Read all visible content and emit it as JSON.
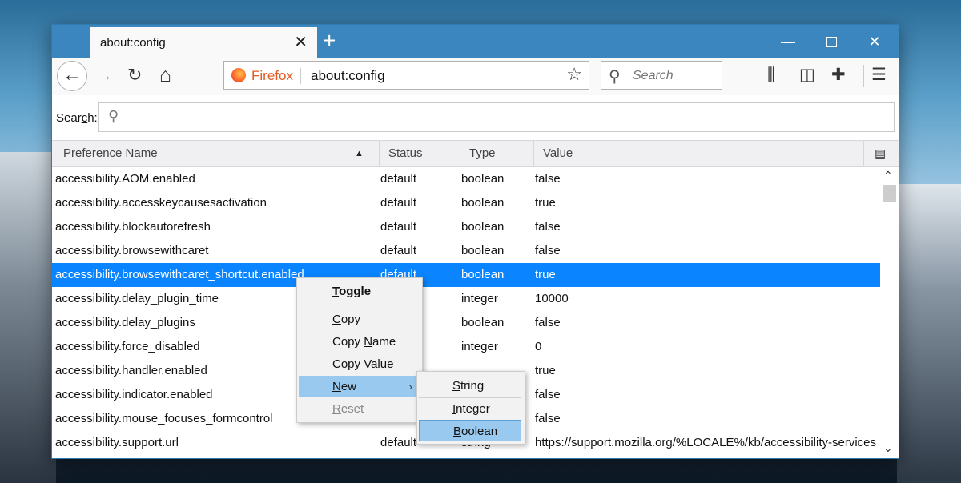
{
  "tab": {
    "title": "about:config",
    "close_glyph": "✕",
    "new_tab_glyph": "+"
  },
  "window_controls": {
    "minimize": "—",
    "close": "✕"
  },
  "navbar": {
    "back_glyph": "←",
    "forward_glyph": "→",
    "reload_glyph": "↻",
    "home_glyph": "⌂",
    "identity_label": "Firefox",
    "url": "about:config",
    "star_glyph": "☆",
    "search_placeholder": "Search",
    "search_glyph": "⚲",
    "library_glyph": "⫼",
    "sidebar_glyph": "◫",
    "extensions_glyph": "✚",
    "menu_glyph": "☰"
  },
  "filter": {
    "label_prefix": "Sear",
    "label_underlined": "c",
    "label_suffix": "h:",
    "icon_glyph": "⚲",
    "value": ""
  },
  "columns": {
    "name": "Preference Name",
    "status": "Status",
    "type": "Type",
    "value": "Value",
    "sort_glyph": "▲",
    "picker_glyph": "▤"
  },
  "rows": [
    {
      "name": "accessibility.AOM.enabled",
      "status": "default",
      "type": "boolean",
      "value": "false"
    },
    {
      "name": "accessibility.accesskeycausesactivation",
      "status": "default",
      "type": "boolean",
      "value": "true"
    },
    {
      "name": "accessibility.blockautorefresh",
      "status": "default",
      "type": "boolean",
      "value": "false"
    },
    {
      "name": "accessibility.browsewithcaret",
      "status": "default",
      "type": "boolean",
      "value": "false"
    },
    {
      "name": "accessibility.browsewithcaret_shortcut.enabled",
      "status": "default",
      "type": "boolean",
      "value": "true"
    },
    {
      "name": "accessibility.delay_plugin_time",
      "status": "",
      "type": "integer",
      "value": "10000"
    },
    {
      "name": "accessibility.delay_plugins",
      "status": "",
      "type": "boolean",
      "value": "false"
    },
    {
      "name": "accessibility.force_disabled",
      "status": "",
      "type": "integer",
      "value": "0"
    },
    {
      "name": "accessibility.handler.enabled",
      "status": "",
      "type": "",
      "value": "true"
    },
    {
      "name": "accessibility.indicator.enabled",
      "status": "",
      "type": "",
      "value": "false"
    },
    {
      "name": "accessibility.mouse_focuses_formcontrol",
      "status": "",
      "type": "",
      "value": "false"
    },
    {
      "name": "accessibility.support.url",
      "status": "default",
      "type": "string",
      "value": "https://support.mozilla.org/%LOCALE%/kb/accessibility-services"
    }
  ],
  "selected_row": 4,
  "context_menu": {
    "toggle": {
      "pre": "",
      "u": "T",
      "post": "oggle"
    },
    "copy": {
      "pre": "",
      "u": "C",
      "post": "opy"
    },
    "copy_name": {
      "pre": "Copy ",
      "u": "N",
      "post": "ame"
    },
    "copy_value": {
      "pre": "Copy ",
      "u": "V",
      "post": "alue"
    },
    "new": {
      "pre": "",
      "u": "N",
      "post": "ew"
    },
    "reset": {
      "pre": "",
      "u": "R",
      "post": "eset"
    },
    "submenu_glyph": "›"
  },
  "new_submenu": {
    "string": {
      "pre": "",
      "u": "S",
      "post": "tring"
    },
    "integer": {
      "pre": "",
      "u": "I",
      "post": "nteger"
    },
    "boolean": {
      "pre": "",
      "u": "B",
      "post": "oolean"
    }
  },
  "scrollbar": {
    "up_glyph": "⌃",
    "down_glyph": "⌄"
  },
  "colors": {
    "titlebar": "#3b86be",
    "selection": "#0a84ff",
    "menu_highlight": "#99c9ef",
    "firefox_label": "#e35b25"
  }
}
